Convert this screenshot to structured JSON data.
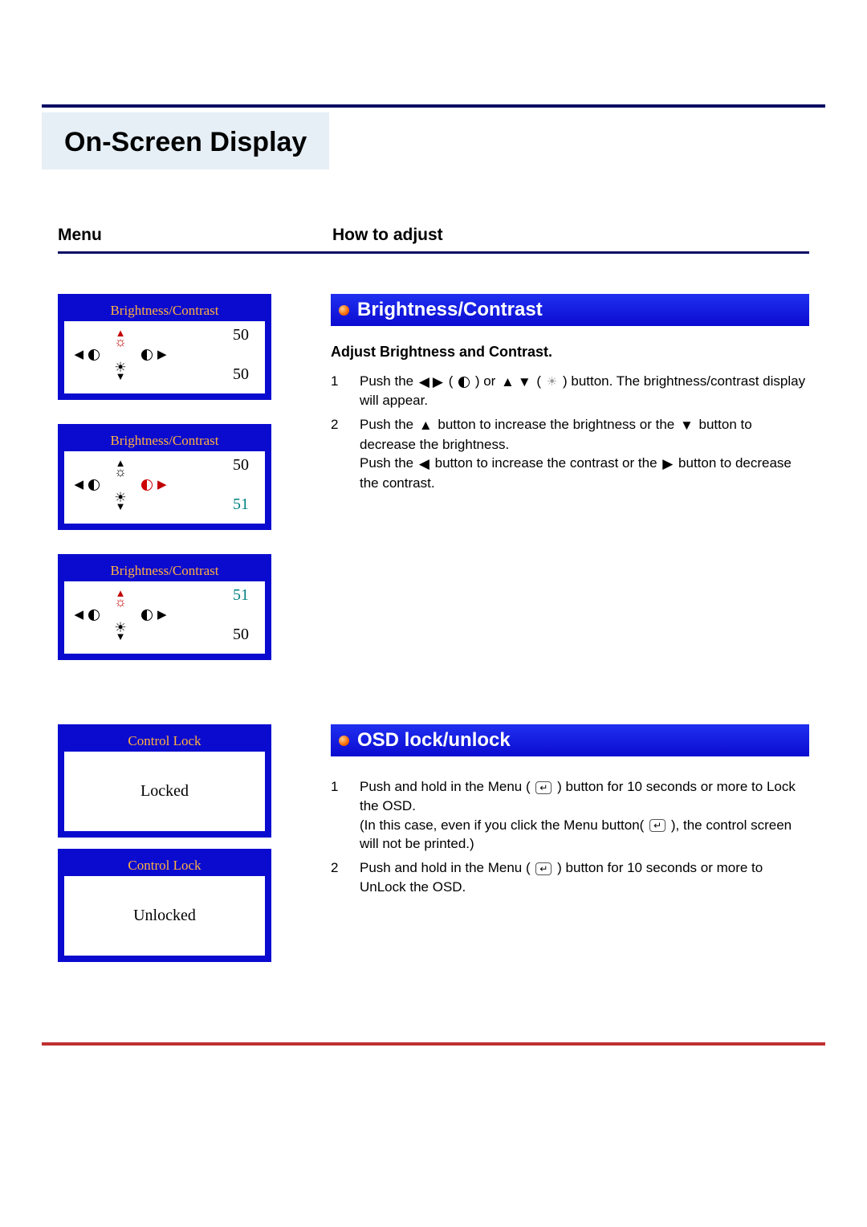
{
  "page_title": "On-Screen Display",
  "columns": {
    "menu": "Menu",
    "how": "How to adjust"
  },
  "osd_panels": [
    {
      "title": "Brightness/Contrast",
      "top": "50",
      "bottom": "50",
      "top_sel": true,
      "bottom_sel": false
    },
    {
      "title": "Brightness/Contrast",
      "top": "50",
      "bottom": "51",
      "top_sel": false,
      "bottom_sel": true,
      "bottom_teal": true
    },
    {
      "title": "Brightness/Contrast",
      "top": "51",
      "bottom": "50",
      "top_sel": true,
      "bottom_sel": false,
      "top_teal": true
    }
  ],
  "brightness_section": {
    "heading": "Brightness/Contrast",
    "subheading": "Adjust Brightness and Contrast.",
    "steps": [
      {
        "num": "1",
        "prefix": "Push the ",
        "mid": " or ",
        "suffix": " button. The brightness/contrast display will appear."
      },
      {
        "num": "2",
        "line1a": "Push the ",
        "line1b": " button to increase the brightness or the ",
        "line1c": " button to decrease the brightness.",
        "line2a": "Push the ",
        "line2b": " button to increase the contrast or the ",
        "line2c": " button to decrease the contrast."
      }
    ]
  },
  "lock_panels": [
    {
      "title": "Control Lock",
      "state": "Locked"
    },
    {
      "title": "Control Lock",
      "state": "Unlocked"
    }
  ],
  "lock_section": {
    "heading": "OSD lock/unlock",
    "steps": [
      {
        "num": "1",
        "a": "Push and hold in the Menu ( ",
        "b": " ) button for 10 seconds or more to Lock the OSD.",
        "c": "(In this case, even if you click the Menu button( ",
        "d": " ), the control screen will not be printed.)"
      },
      {
        "num": "2",
        "a": "Push and hold in the Menu ( ",
        "b": " ) button for 10 seconds or more to UnLock the OSD."
      }
    ]
  }
}
